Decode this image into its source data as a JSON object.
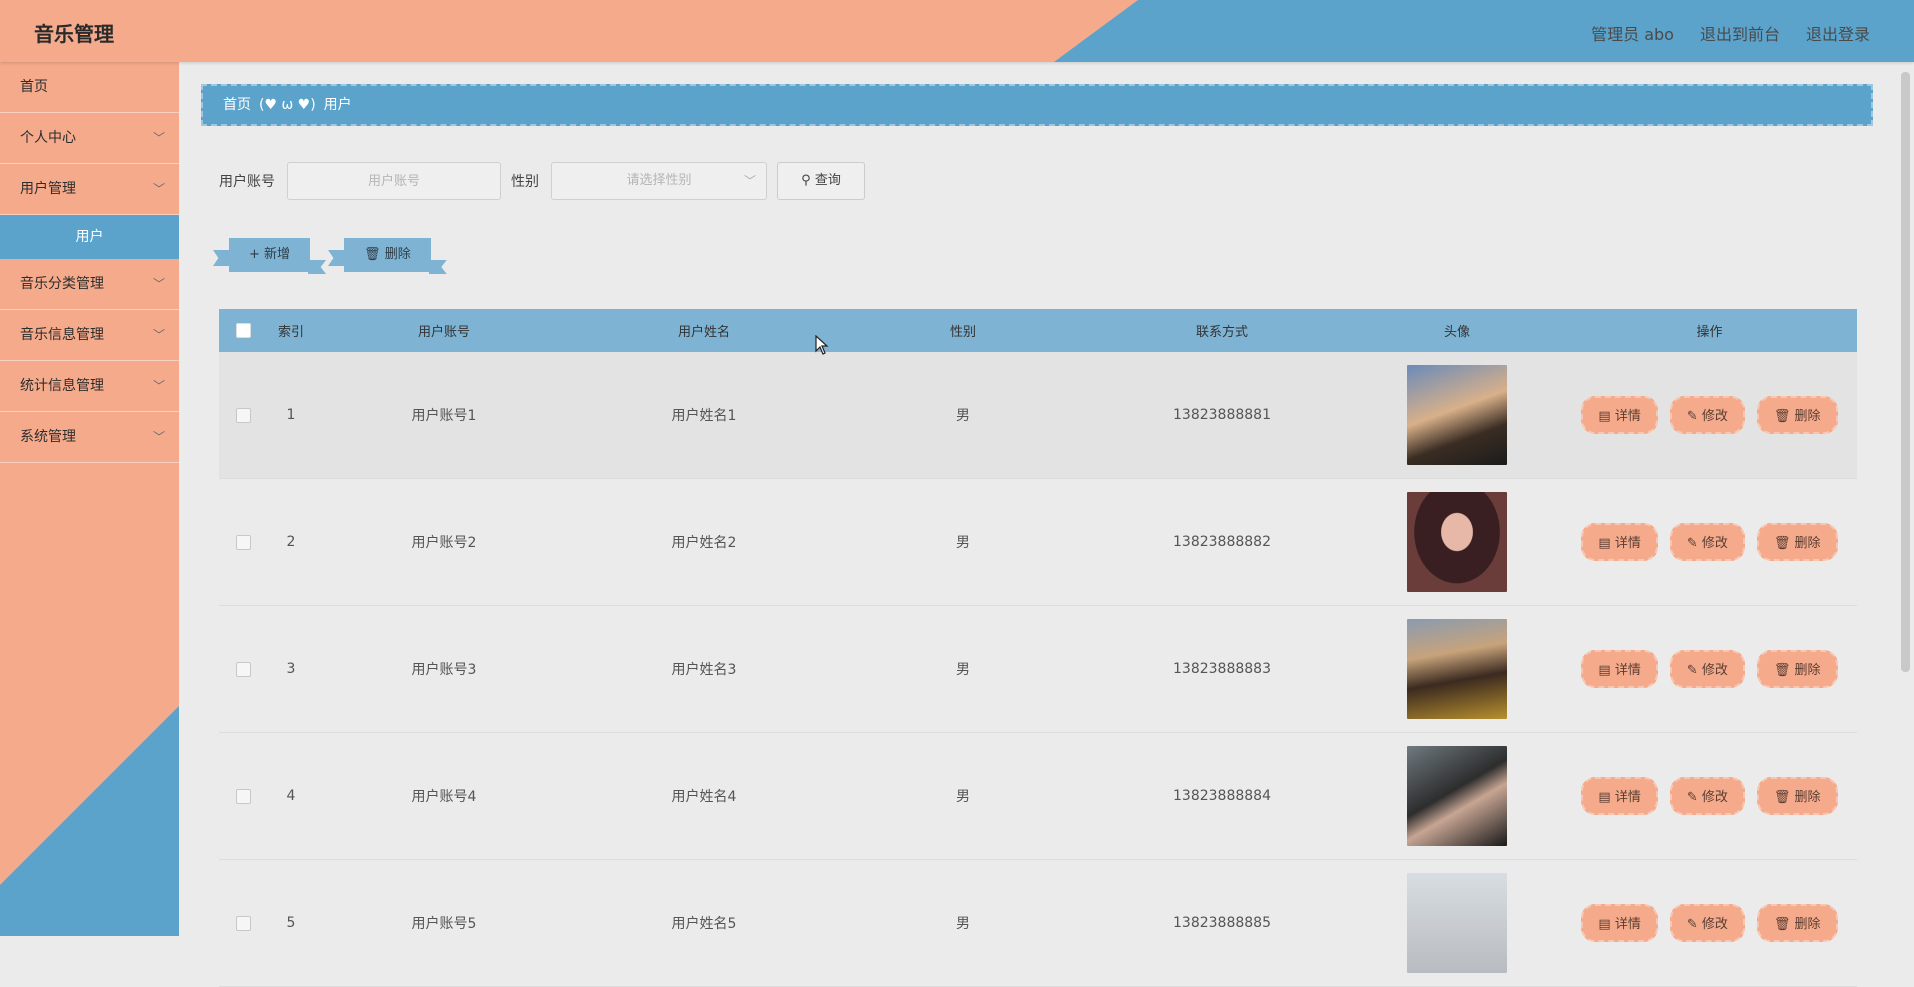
{
  "header": {
    "logo": "音乐管理",
    "admin": "管理员 abo",
    "to_front": "退出到前台",
    "logout": "退出登录"
  },
  "sidebar": {
    "items": [
      {
        "label": "首页",
        "has_arrow": false
      },
      {
        "label": "个人中心",
        "has_arrow": true
      },
      {
        "label": "用户管理",
        "has_arrow": true
      },
      {
        "label": "音乐分类管理",
        "has_arrow": true
      },
      {
        "label": "音乐信息管理",
        "has_arrow": true
      },
      {
        "label": "统计信息管理",
        "has_arrow": true
      },
      {
        "label": "系统管理",
        "has_arrow": true
      }
    ],
    "active_sub": "用户"
  },
  "breadcrumb": {
    "home": "首页",
    "separator": "(♥ ω ♥)",
    "current": "用户"
  },
  "search": {
    "account_label": "用户账号",
    "account_placeholder": "用户账号",
    "gender_label": "性别",
    "gender_placeholder": "请选择性别",
    "query_button": "查询"
  },
  "actions": {
    "add": "新增",
    "delete": "删除"
  },
  "table": {
    "headers": {
      "index": "索引",
      "account": "用户账号",
      "name": "用户姓名",
      "gender": "性别",
      "phone": "联系方式",
      "avatar": "头像",
      "ops": "操作"
    },
    "rows": [
      {
        "index": "1",
        "account": "用户账号1",
        "name": "用户姓名1",
        "gender": "男",
        "phone": "13823888881"
      },
      {
        "index": "2",
        "account": "用户账号2",
        "name": "用户姓名2",
        "gender": "男",
        "phone": "13823888882"
      },
      {
        "index": "3",
        "account": "用户账号3",
        "name": "用户姓名3",
        "gender": "男",
        "phone": "13823888883"
      },
      {
        "index": "4",
        "account": "用户账号4",
        "name": "用户姓名4",
        "gender": "男",
        "phone": "13823888884"
      },
      {
        "index": "5",
        "account": "用户账号5",
        "name": "用户姓名5",
        "gender": "男",
        "phone": "13823888885"
      }
    ],
    "op_labels": {
      "detail": "详情",
      "edit": "修改",
      "delete": "删除"
    }
  },
  "colors": {
    "salmon": "#f4aa8b",
    "blue": "#5ba3cb",
    "table_header": "#7eb3d3",
    "background": "#ebebeb"
  }
}
